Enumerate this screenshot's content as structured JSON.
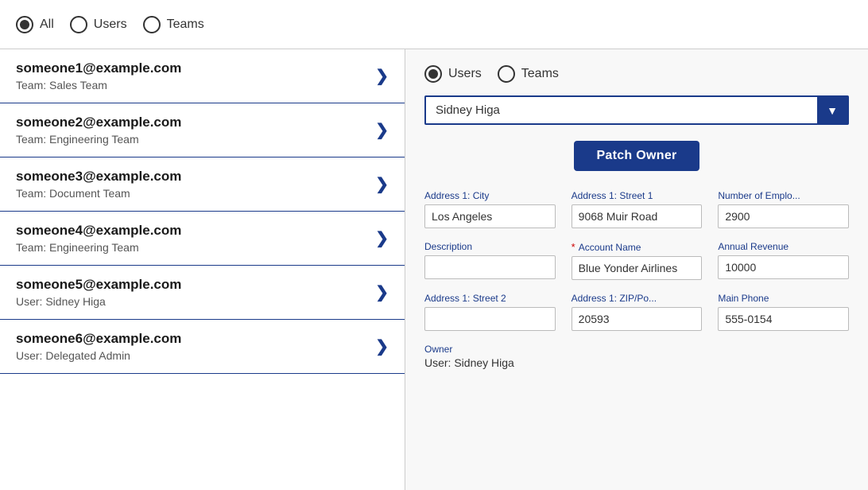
{
  "topBar": {
    "radioOptions": [
      {
        "id": "all",
        "label": "All",
        "selected": true
      },
      {
        "id": "users",
        "label": "Users",
        "selected": false
      },
      {
        "id": "teams",
        "label": "Teams",
        "selected": false
      }
    ]
  },
  "leftPanel": {
    "items": [
      {
        "email": "someone1@example.com",
        "subtext": "Team: Sales Team"
      },
      {
        "email": "someone2@example.com",
        "subtext": "Team: Engineering Team"
      },
      {
        "email": "someone3@example.com",
        "subtext": "Team: Document Team"
      },
      {
        "email": "someone4@example.com",
        "subtext": "Team: Engineering Team"
      },
      {
        "email": "someone5@example.com",
        "subtext": "User: Sidney Higa"
      },
      {
        "email": "someone6@example.com",
        "subtext": "User: Delegated Admin"
      }
    ]
  },
  "rightPanel": {
    "radioOptions": [
      {
        "id": "users",
        "label": "Users",
        "selected": true
      },
      {
        "id": "teams",
        "label": "Teams",
        "selected": false
      }
    ],
    "dropdown": {
      "value": "Sidney Higa",
      "chevron": "▼"
    },
    "patchOwnerLabel": "Patch Owner",
    "fields": [
      {
        "id": "city",
        "label": "Address 1: City",
        "value": "Los Angeles",
        "required": false,
        "col": 1
      },
      {
        "id": "street1",
        "label": "Address 1: Street 1",
        "value": "9068 Muir Road",
        "required": false,
        "col": 2
      },
      {
        "id": "numEmployees",
        "label": "Number of Emplo...",
        "value": "2900",
        "required": false,
        "col": 3
      },
      {
        "id": "description",
        "label": "Description",
        "value": "",
        "required": false,
        "col": 1
      },
      {
        "id": "accountName",
        "label": "Account Name",
        "value": "Blue Yonder Airlines",
        "required": true,
        "col": 2
      },
      {
        "id": "annualRevenue",
        "label": "Annual Revenue",
        "value": "10000",
        "required": false,
        "col": 3
      },
      {
        "id": "street2",
        "label": "Address 1: Street 2",
        "value": "",
        "required": false,
        "col": 1
      },
      {
        "id": "zipCode",
        "label": "Address 1: ZIP/Po...",
        "value": "20593",
        "required": false,
        "col": 2
      },
      {
        "id": "mainPhone",
        "label": "Main Phone",
        "value": "555-0154",
        "required": false,
        "col": 3
      }
    ],
    "owner": {
      "label": "Owner",
      "value": "User: Sidney Higa"
    }
  }
}
